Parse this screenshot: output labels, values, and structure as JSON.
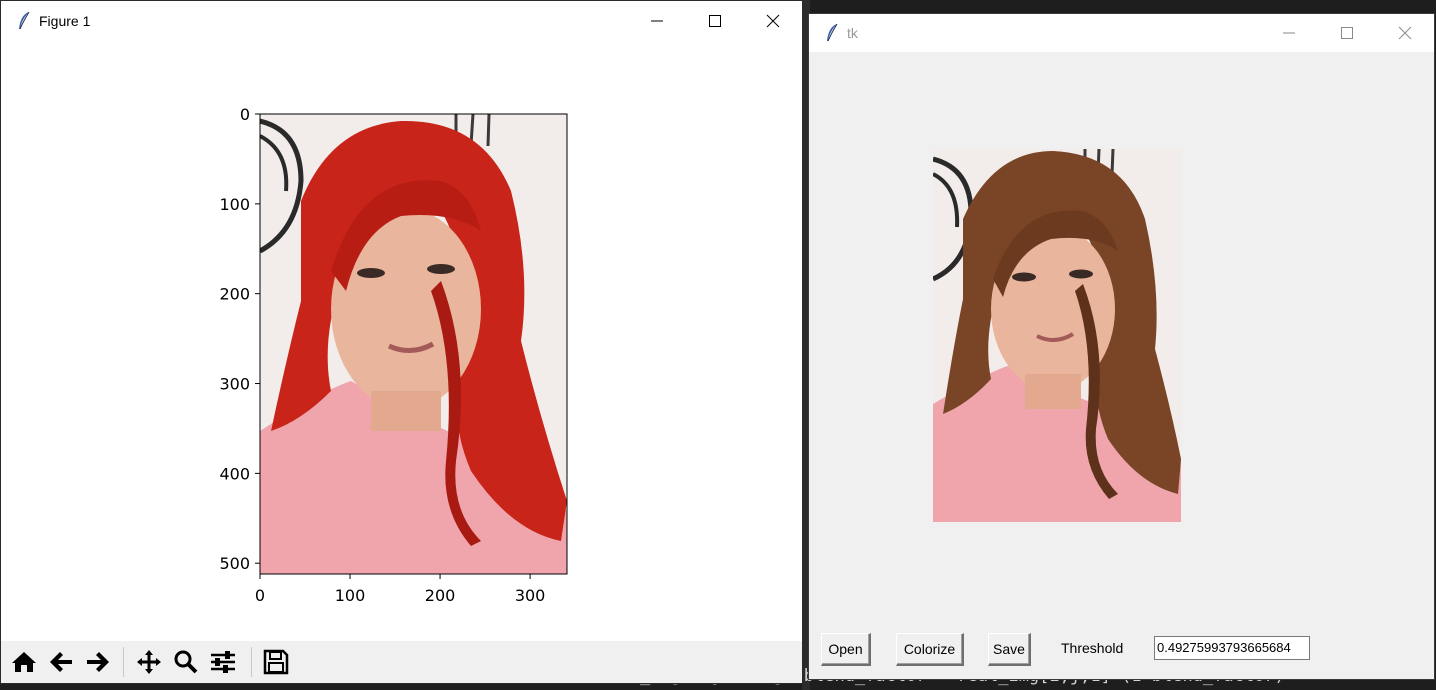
{
  "figure_window": {
    "title": "Figure 1",
    "controls": {
      "minimize": "minimize",
      "maximize": "maximize",
      "close": "close"
    },
    "axes": {
      "y_ticks": [
        "0",
        "100",
        "200",
        "300",
        "400",
        "500"
      ],
      "x_ticks": [
        "0",
        "100",
        "200",
        "300"
      ],
      "xlim": [
        0,
        341
      ],
      "ylim": [
        512,
        0
      ]
    },
    "image": {
      "hair_color": "#c8241a",
      "top_color": "#f0a5ad",
      "background_color": "#f2ecea"
    },
    "toolbar": [
      "home-icon",
      "back-arrow-icon",
      "forward-arrow-icon",
      "pan-icon",
      "zoom-icon",
      "configure-subplots-icon",
      "save-icon"
    ]
  },
  "tk_window": {
    "title": "tk",
    "image": {
      "hair_color": "#7a4526",
      "top_color": "#f0a5ad",
      "background_color": "#f2ecea"
    },
    "buttons": {
      "open": "Open",
      "colorize": "Colorize",
      "save": "Save"
    },
    "threshold_label": "Threshold",
    "threshold_value": "0.49275993793665684"
  },
  "colors": {
    "window_bg": "#f0f0f0",
    "titlebar_bg": "#ffffff",
    "editor_bg": "#1e1e1e"
  }
}
